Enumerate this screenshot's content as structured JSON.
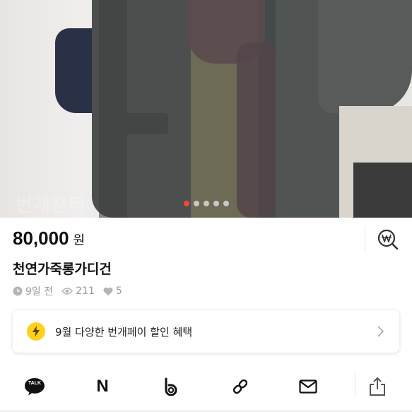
{
  "gallery": {
    "watermark": "번개장터",
    "slide_count": 5,
    "active_slide": 1
  },
  "product": {
    "price": "80,000",
    "currency": "원",
    "title": "천연가죽롱가디건",
    "time_ago": "9일 전",
    "views": "211",
    "likes": "5"
  },
  "promo": {
    "text": "9월 다양한 번개페이 할인 혜택",
    "icon": "lightning-icon"
  },
  "share": {
    "items": [
      {
        "name": "kakaotalk",
        "label": "TALK"
      },
      {
        "name": "naver",
        "label": "N"
      },
      {
        "name": "band",
        "label": "b"
      },
      {
        "name": "link",
        "label": ""
      },
      {
        "name": "mail",
        "label": ""
      },
      {
        "name": "share",
        "label": ""
      }
    ]
  },
  "colors": {
    "accent_dot": "#f04a3a",
    "promo_bolt": "#ffd11a",
    "meta_text": "#9a9a9a"
  }
}
